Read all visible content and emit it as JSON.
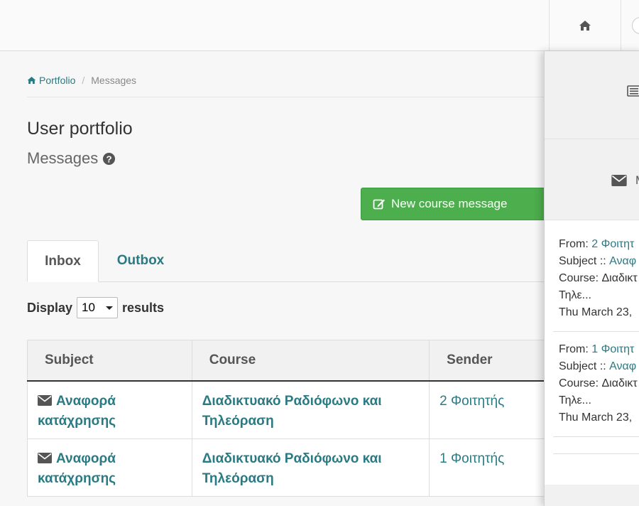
{
  "breadcrumb": {
    "home": "Portfolio",
    "current": "Messages"
  },
  "page": {
    "title": "User portfolio",
    "subtitle": "Messages"
  },
  "actions": {
    "new_course_message": "New course message"
  },
  "tabs": [
    {
      "label": "Inbox",
      "active": true
    },
    {
      "label": "Outbox",
      "active": false
    }
  ],
  "display": {
    "prefix": "Display",
    "value": "10",
    "suffix": "results"
  },
  "table": {
    "headers": [
      "Subject",
      "Course",
      "Sender"
    ],
    "rows": [
      {
        "subject": "Αναφορά κατάχρησης",
        "course": "Διαδικτυακό Ραδιόφωνο και Τηλεόραση",
        "sender": "2 Φοιτητής"
      },
      {
        "subject": "Αναφορά κατάχρησης",
        "course": "Διαδικτυακό Ραδιόφωνο και Τηλεόραση",
        "sender": "1 Φοιτητής"
      }
    ]
  },
  "side_panel": {
    "items": [
      {
        "from_label": "From:",
        "from": "2 Φοιτητ",
        "subject_label": "Subject ::",
        "subject": "Αναφ",
        "course_line1": "Course: Διαδικτ",
        "course_line2": "Τηλε...",
        "date": "Thu March 23,"
      },
      {
        "from_label": "From:",
        "from": "1 Φοιτητ",
        "subject_label": "Subject ::",
        "subject": "Αναφ",
        "course_line1": "Course: Διαδικτ",
        "course_line2": "Τηλε...",
        "date": "Thu March 23,"
      }
    ]
  },
  "colors": {
    "accent": "#2a7a83",
    "success": "#4cae4c"
  }
}
